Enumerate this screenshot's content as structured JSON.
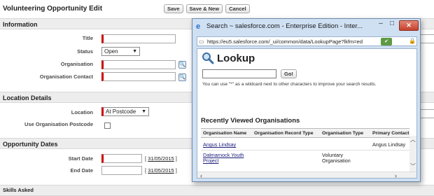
{
  "page": {
    "title": "Volunteering Opportunity Edit",
    "buttons": {
      "save": "Save",
      "save_new": "Save & New",
      "cancel": "Cancel"
    }
  },
  "sections": {
    "information": "Information",
    "location_details": "Location Details",
    "opportunity_dates": "Opportunity Dates",
    "skills": "Skills Asked"
  },
  "fields": {
    "title_label": "Title",
    "status_label": "Status",
    "status_value": "Open",
    "organisation_label": "Organisation",
    "organisation_contact_label": "Organisation Contact",
    "location_label": "Location",
    "location_value": "At Postcode",
    "use_postcode_label": "Use Organisation Postcode",
    "start_date_label": "Start Date",
    "end_date_label": "End Date",
    "start_date_link": "31/05/2015",
    "end_date_link": "31/05/2015"
  },
  "popup": {
    "window_title": "Search ~ salesforce.com - Enterprise Edition - Inter...",
    "url": "https://eu5.salesforce.com/_ui/common/data/LookupPage?lkfm=ed",
    "heading": "Lookup",
    "go_label": "Go!",
    "help_text": "You can use \"*\" as a wildcard next to other characters to improve your search results.",
    "recent_heading": "Recently Viewed Organisations",
    "columns": [
      "Organisation Name",
      "Organisation Record Type",
      "Organisation Type",
      "Primary Contact"
    ],
    "rows": [
      {
        "name": "Angus Lindsay",
        "record_type": "",
        "org_type": "",
        "contact": "Angus Lindsay"
      },
      {
        "name": "Dalmarnock Youth Project",
        "record_type": "",
        "org_type": "Voluntary Organisation",
        "contact": ""
      }
    ]
  },
  "icons": {
    "browser": "ie-icon",
    "lookup": "magnifier-icon",
    "certificate": "certificate-icon",
    "lock": "lock-icon"
  },
  "colors": {
    "required_marker": "#cc0000",
    "section_bar": "#ededed",
    "popup_frame": "#cfe0f3",
    "close_button": "#c5412b"
  }
}
